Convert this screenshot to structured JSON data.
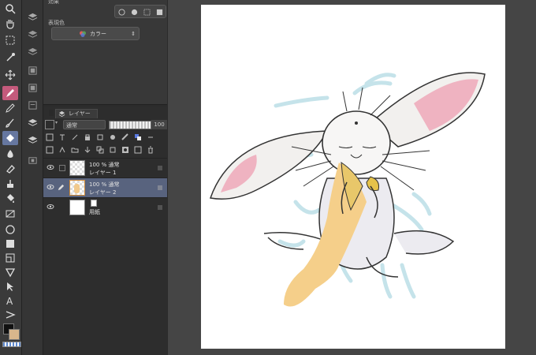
{
  "properties": {
    "effect_label": "効果",
    "expression_color_label": "表現色",
    "color_value": "カラー"
  },
  "layer_panel": {
    "tab_label": "レイヤー",
    "blend_mode": "通常",
    "opacity": "100",
    "layers": [
      {
        "line1": "100 % 通常",
        "line2": "レイヤー 1",
        "selected": false
      },
      {
        "line1": "100 % 通常",
        "line2": "レイヤー 2",
        "selected": true
      },
      {
        "line1": "",
        "line2": "用紙",
        "selected": false
      }
    ]
  },
  "colors": {
    "main_color": "#111111",
    "sub_color": "#d9b68c",
    "selection": "#58637e",
    "paper": "#ffffff"
  }
}
